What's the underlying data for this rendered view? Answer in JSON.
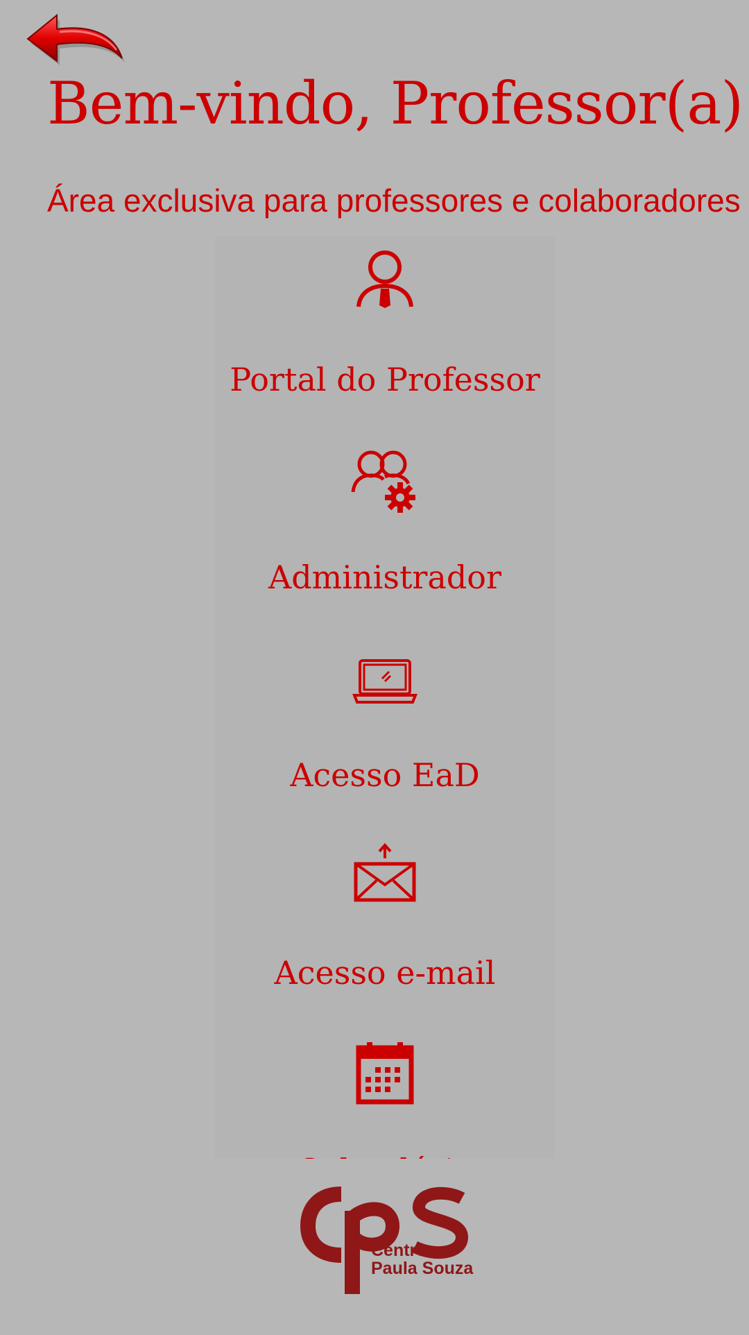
{
  "header": {
    "back_icon": "back-arrow-icon",
    "title": "Bem-vindo, Professor(a)!",
    "subtitle": "Área exclusiva para professores e colaboradores"
  },
  "menu": {
    "items": [
      {
        "label": "Portal do Professor",
        "icon": "professor-user-icon"
      },
      {
        "label": "Administrador",
        "icon": "admin-users-gear-icon"
      },
      {
        "label": "Acesso EaD",
        "icon": "laptop-icon"
      },
      {
        "label": "Acesso e-mail",
        "icon": "email-icon"
      },
      {
        "label": "Calendário",
        "icon": "calendar-icon"
      }
    ]
  },
  "footer": {
    "logo_mark": "cps",
    "logo_line1": "Centro",
    "logo_line2": "Paula Souza"
  },
  "colors": {
    "accent": "#cc0000",
    "background": "#b7b7b7",
    "logo": "#8f1717"
  }
}
